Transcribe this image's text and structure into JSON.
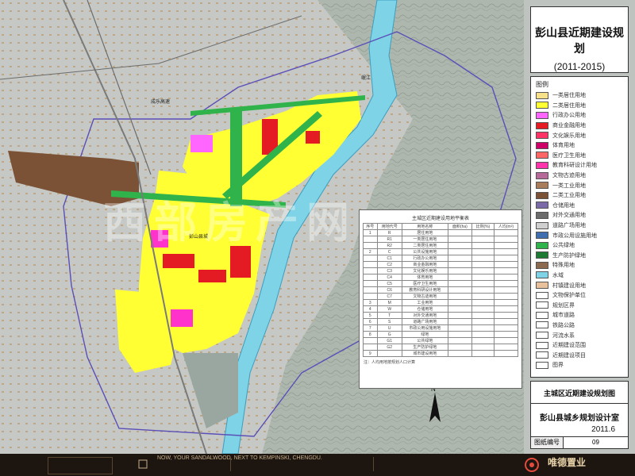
{
  "title": {
    "main": "彭山县近期建设规划",
    "years": "(2011-2015)"
  },
  "legend": {
    "heading": "图例",
    "items": [
      {
        "label": "一类居住用地",
        "color": "#f7e08a"
      },
      {
        "label": "二类居住用地",
        "color": "#ffff33"
      },
      {
        "label": "行政办公用地",
        "color": "#ff66ff"
      },
      {
        "label": "商业金融用地",
        "color": "#e51b24"
      },
      {
        "label": "文化娱乐用地",
        "color": "#ff3366"
      },
      {
        "label": "体育用地",
        "color": "#cc0066"
      },
      {
        "label": "医疗卫生用地",
        "color": "#ff6666"
      },
      {
        "label": "教育科研设计用地",
        "color": "#ff33aa"
      },
      {
        "label": "文物古迹用地",
        "color": "#b76a9a"
      },
      {
        "label": "一类工业用地",
        "color": "#a97d5b"
      },
      {
        "label": "二类工业用地",
        "color": "#7c5236"
      },
      {
        "label": "仓储用地",
        "color": "#7b6aa8"
      },
      {
        "label": "对外交通用地",
        "color": "#6b6b6b"
      },
      {
        "label": "道路广场用地",
        "color": "#cfcfcf"
      },
      {
        "label": "市政公用设施用地",
        "color": "#3f6fae"
      },
      {
        "label": "公共绿地",
        "color": "#2fb34a"
      },
      {
        "label": "生产防护绿地",
        "color": "#1f7a34"
      },
      {
        "label": "特殊用地",
        "color": "#8c6a4f"
      },
      {
        "label": "水域",
        "color": "#7fd3e6"
      },
      {
        "label": "村镇建设用地",
        "color": "#e8c19c"
      },
      {
        "label": "文物保护单位",
        "color": "#ffffff"
      },
      {
        "label": "规划区界",
        "color": "#ffffff"
      },
      {
        "label": "城市道路",
        "color": "#ffffff"
      },
      {
        "label": "铁路公路",
        "color": "#ffffff"
      },
      {
        "label": "河流水系",
        "color": "#ffffff"
      },
      {
        "label": "近期建设范围",
        "color": "#ffffff"
      },
      {
        "label": "近期建设项目",
        "color": "#ffffff"
      },
      {
        "label": "图界",
        "color": "#ffffff"
      }
    ]
  },
  "subtitle": "主城区近期建设规划图",
  "org": "彭山县城乡规划设计室",
  "date": "2011.6",
  "sheet": {
    "key": "图纸编号",
    "value": "09"
  },
  "table": {
    "title": "主城区近期建设用地平衡表",
    "headers": [
      "序号",
      "用地代号",
      "用地名称",
      "面积(ha)",
      "比例(%)",
      "人均(m²)"
    ],
    "rows": [
      [
        "1",
        "R",
        "居住用地",
        "",
        "",
        ""
      ],
      [
        "",
        "R1",
        "一类居住用地",
        "",
        "",
        ""
      ],
      [
        "",
        "R2",
        "二类居住用地",
        "",
        "",
        ""
      ],
      [
        "2",
        "C",
        "公共设施用地",
        "",
        "",
        ""
      ],
      [
        "",
        "C1",
        "行政办公用地",
        "",
        "",
        ""
      ],
      [
        "",
        "C2",
        "商业金融用地",
        "",
        "",
        ""
      ],
      [
        "",
        "C3",
        "文化娱乐用地",
        "",
        "",
        ""
      ],
      [
        "",
        "C4",
        "体育用地",
        "",
        "",
        ""
      ],
      [
        "",
        "C5",
        "医疗卫生用地",
        "",
        "",
        ""
      ],
      [
        "",
        "C6",
        "教育科研设计用地",
        "",
        "",
        ""
      ],
      [
        "",
        "C7",
        "文物古迹用地",
        "",
        "",
        ""
      ],
      [
        "3",
        "M",
        "工业用地",
        "",
        "",
        ""
      ],
      [
        "4",
        "W",
        "仓储用地",
        "",
        "",
        ""
      ],
      [
        "5",
        "T",
        "对外交通用地",
        "",
        "",
        ""
      ],
      [
        "6",
        "S",
        "道路广场用地",
        "",
        "",
        ""
      ],
      [
        "7",
        "U",
        "市政公用设施用地",
        "",
        "",
        ""
      ],
      [
        "8",
        "G",
        "绿地",
        "",
        "",
        ""
      ],
      [
        "",
        "G1",
        "公共绿地",
        "",
        "",
        ""
      ],
      [
        "",
        "G2",
        "生产防护绿地",
        "",
        "",
        ""
      ],
      [
        "9",
        "",
        "城市建设用地",
        "",
        "",
        ""
      ]
    ],
    "note": "注：人均用地按规划人口计算"
  },
  "watermark": "西部房产网",
  "place_labels": [
    {
      "text": "成乐高速"
    },
    {
      "text": "岷江"
    },
    {
      "text": "彭山县城"
    }
  ],
  "footer": {
    "slogan": "NOW, YOUR SANDALWOOD, NEXT TO KEMPINSKI, CHENGDU.",
    "brand": "唯德置业"
  }
}
